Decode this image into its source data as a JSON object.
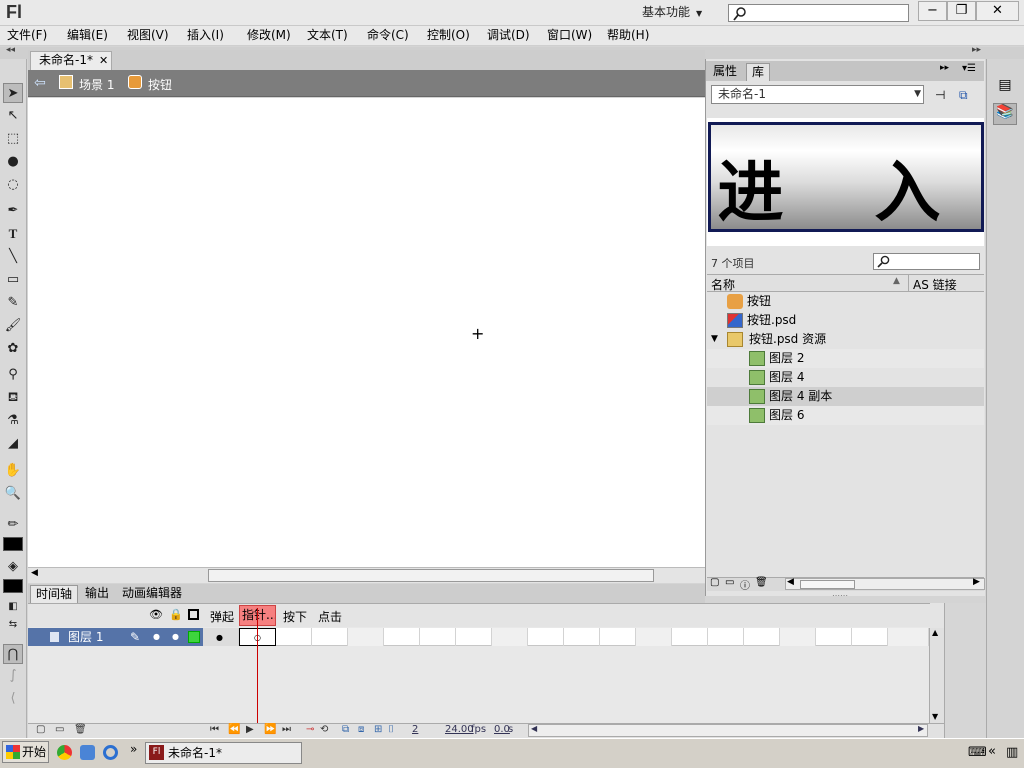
{
  "app": {
    "logo": "Fl",
    "workspace": "基本功能",
    "search_placeholder": ""
  },
  "menus": [
    "文件(F)",
    "编辑(E)",
    "视图(V)",
    "插入(I)",
    "修改(M)",
    "文本(T)",
    "命令(C)",
    "控制(O)",
    "调试(D)",
    "窗口(W)",
    "帮助(H)"
  ],
  "document": {
    "tab_label": "未命名-1*",
    "breadcrumb_scene": "场景 1",
    "breadcrumb_symbol": "按钮"
  },
  "panels": {
    "tab_properties": "属性",
    "tab_library": "库",
    "library_doc": "未命名-1",
    "preview_text": "进 入",
    "item_count": "7 个项目",
    "col_name": "名称",
    "col_linkage": "AS 链接",
    "items": [
      {
        "label": "按钮",
        "icon": "button-symbol-icon"
      },
      {
        "label": "按钮.psd",
        "icon": "bitmap-icon"
      },
      {
        "label": "按钮.psd 资源",
        "icon": "folder-open-icon"
      },
      {
        "label": "图层 2",
        "icon": "bitmap-icon"
      },
      {
        "label": "图层 4",
        "icon": "bitmap-icon"
      },
      {
        "label": "图层 4 副本",
        "icon": "bitmap-icon"
      },
      {
        "label": "图层 6",
        "icon": "bitmap-icon"
      }
    ]
  },
  "timeline": {
    "tabs": [
      "时间轴",
      "输出",
      "动画编辑器"
    ],
    "frame_labels": [
      "弹起",
      "指针...",
      "按下",
      "点击"
    ],
    "layer_name": "图层 1",
    "current_frame": "2",
    "fps": "24.00",
    "fps_unit": "fps",
    "elapsed": "0.0",
    "elapsed_unit": "s"
  },
  "taskbar": {
    "start": "开始",
    "task_label": "未命名-1*"
  }
}
